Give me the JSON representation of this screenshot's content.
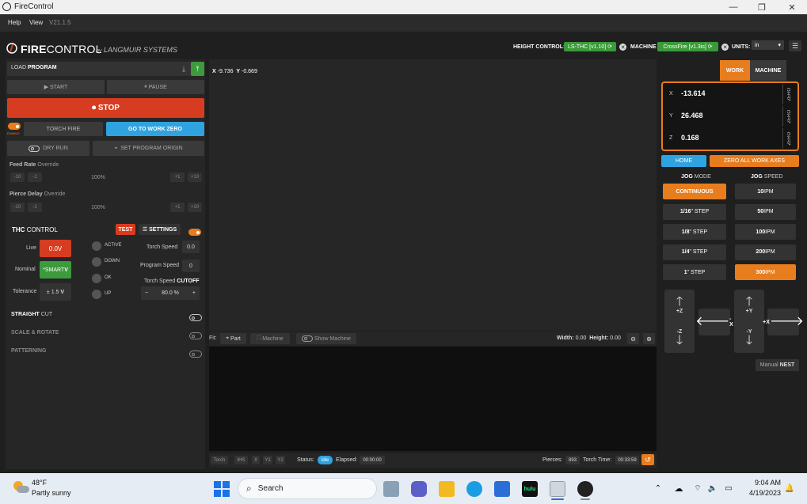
{
  "window": {
    "title": "FireControl"
  },
  "menu": {
    "help": "Help",
    "view": "View",
    "version": "V21.1.5"
  },
  "header": {
    "brand_fire": "FIRE",
    "brand_control": "CONTROL",
    "brand_by": "by",
    "brand_langmuir": "LANGMUIR SYSTEMS",
    "height_control_label": "HEIGHT CONTROL:",
    "height_control_value": "LS-THC [v1.10]",
    "machine_label": "MACHINE",
    "machine_value": "CrossFire [v1.3is]",
    "units_label": "UNITS:",
    "units_value": "in"
  },
  "left": {
    "load_program": "LOAD",
    "load_program_bold": "PROGRAM",
    "start": "START",
    "pause": "PAUSE",
    "stop": "STOP",
    "enable": "ENABLE",
    "torch_fire": "TORCH FIRE",
    "go_to_work_zero": "GO TO WORK ZERO",
    "dry_run": "DRY RUN",
    "set_program_origin": "SET PROGRAM ORIGIN",
    "feed_rate": {
      "label": "Feed Rate",
      "suffix": "Override",
      "minus10": "-10",
      "minus1": "-1",
      "value": "100%",
      "plus1": "+1",
      "plus10": "+10"
    },
    "pierce_delay": {
      "label": "Pierce Delay",
      "suffix": "Override",
      "minus10": "-10",
      "minus1": "-1",
      "value": "100%",
      "plus1": "+1",
      "plus10": "+10"
    },
    "thc": {
      "title_bold": "THC",
      "title": "CONTROL",
      "test": "TEST",
      "settings": "SETTINGS",
      "live_label": "Live",
      "live_value": "0.0V",
      "nominal_label": "Nominal",
      "nominal_value": "*SMART",
      "nominal_unit": "V",
      "tolerance_label": "Tolerance",
      "tolerance_value": "± 1.5",
      "tolerance_unit": "V",
      "active": "ACTIVE",
      "down": "DOWN",
      "ok": "OK",
      "up": "UP",
      "torch_speed_label": "Torch Speed",
      "torch_speed_value": "0.0",
      "program_speed_label": "Program Speed",
      "program_speed_value": "0",
      "cutoff_label": "Torch Speed",
      "cutoff_bold": "CUTOFF",
      "cutoff_minus": "−",
      "cutoff_value": "80.0 %",
      "cutoff_plus": "+"
    },
    "straight_cut_bold": "STRAIGHT",
    "straight_cut": "CUT",
    "scale_rotate": "SCALE & ROTATE",
    "patterning": "PATTERNING"
  },
  "canvas": {
    "x_label": "X",
    "x_value": "-9.736",
    "y_label": "Y",
    "y_value": "-0.669",
    "fit_label": "Fit:",
    "part": "Part",
    "machine": "Machine",
    "show_machine": "Show Machine",
    "width_label": "Width:",
    "width_value": "0.00",
    "height_label": "Height:",
    "height_value": "0.00"
  },
  "status": {
    "torch": "Torch",
    "ihs": "IHS",
    "x": "X",
    "y1": "Y1",
    "y2": "Y2",
    "status_label": "Status:",
    "status_value": "Idle",
    "elapsed_label": "Elapsed:",
    "elapsed_value": "00:00:00",
    "pierces_label": "Pierces:",
    "pierces_value": "893",
    "torch_time_label": "Torch Time:",
    "torch_time_value": "00:33:59"
  },
  "right": {
    "work": "WORK",
    "machine": "MACHINE",
    "axes": [
      {
        "label": "X",
        "value": "-13.614",
        "zero": "ZERO"
      },
      {
        "label": "Y",
        "value": "26.468",
        "zero": "ZERO"
      },
      {
        "label": "Z",
        "value": "0.168",
        "zero": "ZERO"
      }
    ],
    "home": "HOME",
    "zero_all": "ZERO ALL WORK AXES",
    "jog_mode_bold": "JOG",
    "jog_mode": "MODE",
    "jog_speed_bold": "JOG",
    "jog_speed": "SPEED",
    "modes": [
      {
        "bold": "CONTINUOUS",
        "rest": ""
      },
      {
        "bold": "1/16",
        "rest": "\" STEP"
      },
      {
        "bold": "1/8",
        "rest": "\" STEP"
      },
      {
        "bold": "1/4",
        "rest": "\" STEP"
      },
      {
        "bold": "1",
        "rest": "\" STEP"
      }
    ],
    "speeds": [
      {
        "bold": "10",
        "rest": " IPM"
      },
      {
        "bold": "50",
        "rest": " IPM"
      },
      {
        "bold": "100",
        "rest": " IPM"
      },
      {
        "bold": "200",
        "rest": " IPM"
      },
      {
        "bold": "300",
        "rest": " IPM"
      }
    ],
    "plus_z": "+Z",
    "minus_z": "-Z",
    "minus_x": "-X",
    "plus_y": "+Y",
    "minus_y": "-Y",
    "plus_x": "+X",
    "manual": "Manual",
    "nest": "NEST"
  },
  "taskbar": {
    "temp": "48°F",
    "weather": "Partly sunny",
    "search": "Search",
    "time": "9:04 AM",
    "date": "4/19/2023"
  },
  "colors": {
    "accent": "#e87d1e",
    "stop": "#d63c1f",
    "blue": "#2fa3e0",
    "green": "#3d9a3d"
  }
}
